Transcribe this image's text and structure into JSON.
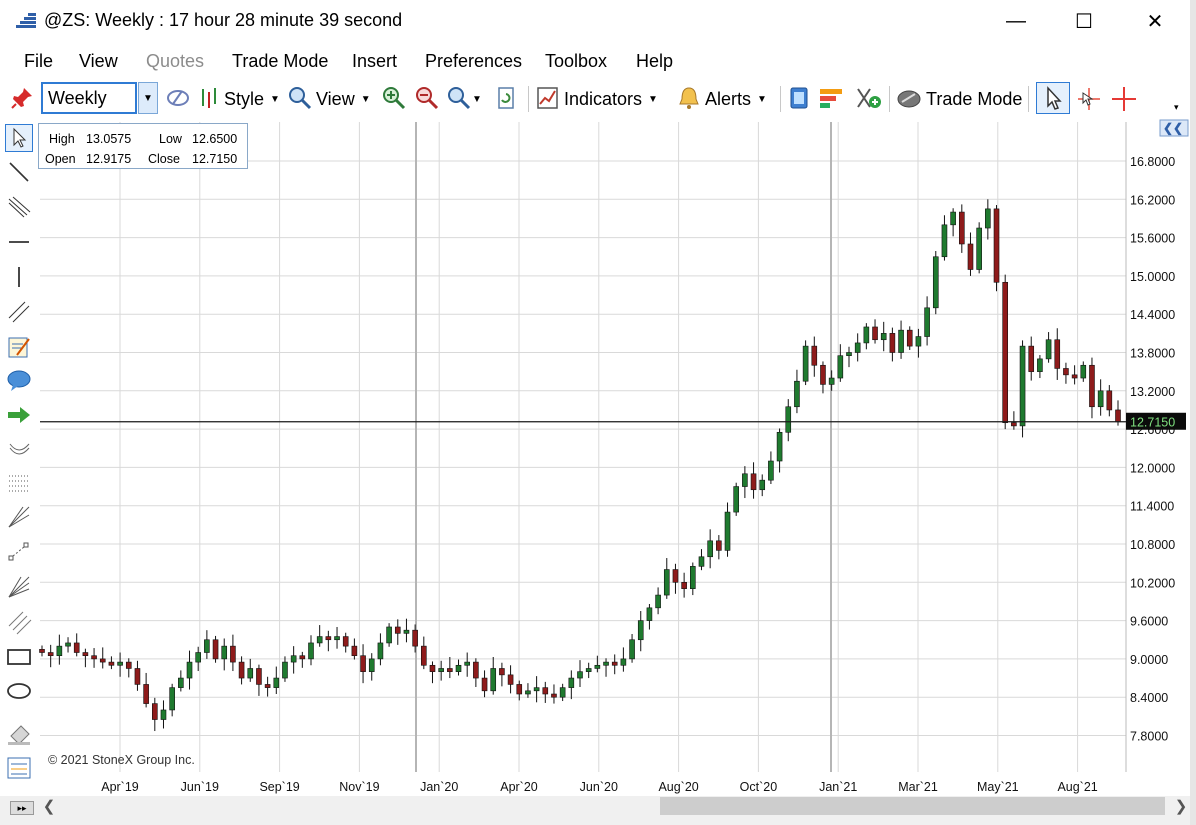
{
  "window": {
    "title": "@ZS: Weekly : 17 hour 28 minute 39 second",
    "minimize": "—",
    "maximize": "☐",
    "close": "✕"
  },
  "menu": {
    "items": [
      {
        "label": "File",
        "enabled": true
      },
      {
        "label": "View",
        "enabled": true
      },
      {
        "label": "Quotes",
        "enabled": false
      },
      {
        "label": "Trade Mode",
        "enabled": true
      },
      {
        "label": "Insert",
        "enabled": true
      },
      {
        "label": "Preferences",
        "enabled": true
      },
      {
        "label": "Toolbox",
        "enabled": true
      },
      {
        "label": "Help",
        "enabled": true
      }
    ]
  },
  "toolbar": {
    "interval": "Weekly",
    "style_label": "Style",
    "view_label": "View",
    "indicators_label": "Indicators",
    "alerts_label": "Alerts",
    "trade_mode_label": "Trade Mode"
  },
  "ohlc": {
    "high_label": "High",
    "high": "13.0575",
    "low_label": "Low",
    "low": "12.6500",
    "open_label": "Open",
    "open": "12.9175",
    "close_label": "Close",
    "close": "12.7150"
  },
  "copyright": "© 2021 StoneX Group Inc.",
  "colors": {
    "up": "#1f7a2f",
    "down": "#8e1b1b",
    "price_tag_bg": "#0b0b0b",
    "price_tag_text": "#7fe07f",
    "grid": "#d9d9d9"
  },
  "chart_data": {
    "type": "candlestick",
    "symbol": "@ZS",
    "interval": "Weekly",
    "last_price": 12.715,
    "last_price_label": "12.7150",
    "ylim": [
      7.5,
      17.2
    ],
    "y_ticks": [
      16.8,
      16.2,
      15.6,
      15.0,
      14.4,
      13.8,
      13.2,
      12.6,
      12.0,
      11.4,
      10.8,
      10.2,
      9.6,
      9.0,
      8.4,
      7.8
    ],
    "y_tick_labels": [
      "16.8000",
      "16.2000",
      "15.6000",
      "15.0000",
      "14.4000",
      "13.8000",
      "13.2000",
      "12.6000",
      "12.0000",
      "11.4000",
      "10.8000",
      "10.2000",
      "9.6000",
      "9.0000",
      "8.4000",
      "7.8000"
    ],
    "x_labels": [
      "Apr`19",
      "Jun`19",
      "Sep`19",
      "Nov`19",
      "Jan`20",
      "Apr`20",
      "Jun`20",
      "Aug`20",
      "Oct`20",
      "Jan`21",
      "Mar`21",
      "May`21",
      "Aug`21"
    ],
    "closes": [
      9.1,
      9.05,
      9.2,
      9.25,
      9.1,
      9.05,
      9.0,
      8.95,
      8.9,
      8.95,
      8.85,
      8.6,
      8.3,
      8.05,
      8.2,
      8.55,
      8.7,
      8.95,
      9.1,
      9.3,
      9.0,
      9.2,
      8.95,
      8.7,
      8.85,
      8.6,
      8.55,
      8.7,
      8.95,
      9.05,
      9.0,
      9.25,
      9.35,
      9.3,
      9.35,
      9.2,
      9.05,
      8.8,
      9.0,
      9.25,
      9.5,
      9.4,
      9.45,
      9.2,
      8.9,
      8.8,
      8.85,
      8.8,
      8.9,
      8.95,
      8.7,
      8.5,
      8.85,
      8.75,
      8.6,
      8.45,
      8.5,
      8.55,
      8.45,
      8.4,
      8.55,
      8.7,
      8.8,
      8.85,
      8.9,
      8.95,
      8.9,
      9.0,
      9.3,
      9.6,
      9.8,
      10.0,
      10.4,
      10.2,
      10.1,
      10.45,
      10.6,
      10.85,
      10.7,
      11.3,
      11.7,
      11.9,
      11.65,
      11.8,
      12.1,
      12.55,
      12.95,
      13.35,
      13.9,
      13.6,
      13.3,
      13.4,
      13.75,
      13.8,
      13.95,
      14.2,
      14.0,
      14.1,
      13.8,
      14.15,
      13.9,
      14.05,
      14.5,
      15.3,
      15.8,
      16.0,
      15.5,
      15.1,
      15.75,
      16.05,
      14.9,
      12.7,
      12.65,
      13.9,
      13.5,
      13.7,
      14.0,
      13.55,
      13.45,
      13.4,
      13.6,
      12.95,
      13.2,
      12.9,
      12.715
    ]
  }
}
